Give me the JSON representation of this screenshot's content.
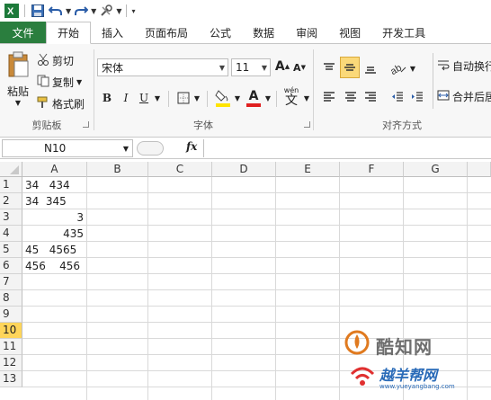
{
  "quick_access": {
    "icons": [
      "excel-logo-icon",
      "save-icon",
      "undo-icon",
      "redo-icon",
      "tools-icon"
    ]
  },
  "tabs": [
    "文件",
    "开始",
    "插入",
    "页面布局",
    "公式",
    "数据",
    "审阅",
    "视图",
    "开发工具"
  ],
  "ribbon": {
    "clipboard": {
      "paste": "粘贴",
      "cut": "剪切",
      "copy": "复制",
      "format_painter": "格式刷",
      "label": "剪贴板"
    },
    "font": {
      "name": "宋体",
      "size": "11",
      "grow": "A",
      "shrink": "A",
      "bold": "B",
      "italic": "I",
      "underline": "U",
      "font_color_letter": "A",
      "phonetic": "wén",
      "label": "字体"
    },
    "alignment": {
      "auto_wrap": "自动换行",
      "merge_center": "合并后居",
      "label": "对齐方式"
    }
  },
  "formula_bar": {
    "name_box": "N10",
    "fx": "fx",
    "content": ""
  },
  "sheet": {
    "columns": [
      "A",
      "B",
      "C",
      "D",
      "E",
      "F",
      "G"
    ],
    "rows": [
      "1",
      "2",
      "3",
      "4",
      "5",
      "6",
      "7",
      "8",
      "9",
      "10",
      "11",
      "12",
      "13"
    ],
    "selected_row": "10",
    "cells": {
      "A1": "34   434",
      "A2": "34  345",
      "A3": "3",
      "A4": "435",
      "A5": "45   4565",
      "A6": "456    456"
    }
  },
  "watermark": {
    "brand1": "酷知网",
    "brand2": "越羊帮网",
    "url": "www.yueyangbang.com"
  },
  "colors": {
    "file_tab": "#2a7e3e",
    "selected_row": "#ffd55a",
    "font_color_bar": "#e02020",
    "highlight_bar": "#ffe400"
  }
}
